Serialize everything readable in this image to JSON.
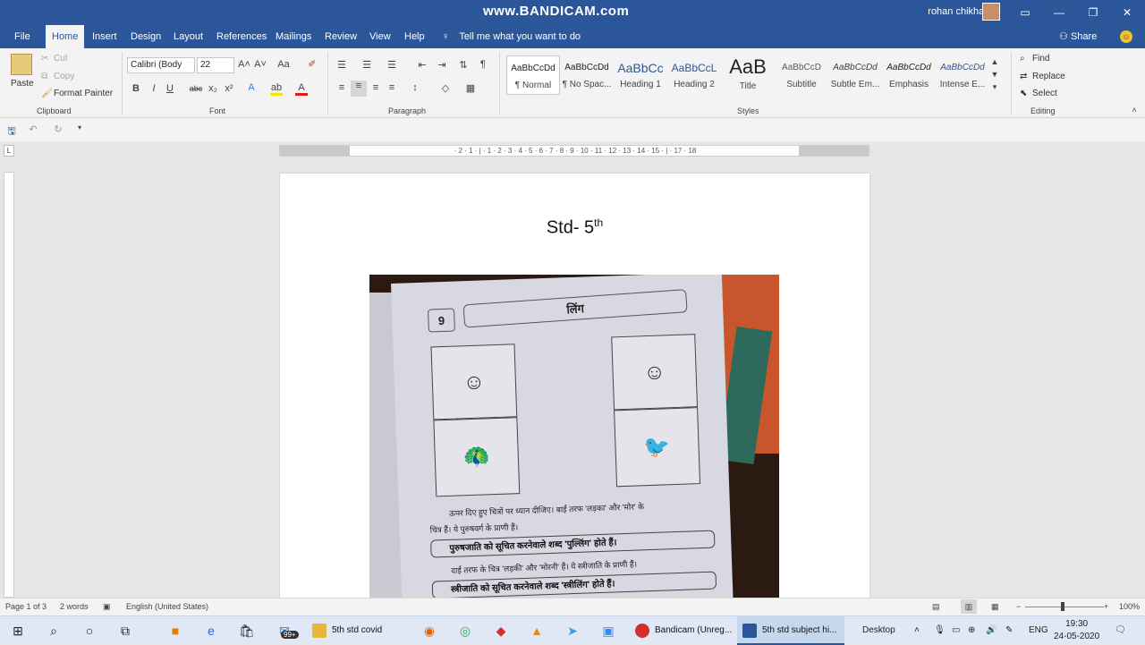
{
  "titlebar": {
    "watermark": "www.BANDICAM.com",
    "user_name": "rohan chikhalkar",
    "minimize": "—",
    "restore": "❐",
    "close": "✕",
    "ribbon_display": "▭"
  },
  "menu": {
    "items": [
      "File",
      "Home",
      "Insert",
      "Design",
      "Layout",
      "References",
      "Mailings",
      "Review",
      "View",
      "Help"
    ],
    "tell_me": "Tell me what you want to do",
    "share": "Share"
  },
  "ribbon": {
    "clipboard": {
      "paste": "Paste",
      "cut": "Cut",
      "copy": "Copy",
      "format_painter": "Format Painter",
      "label": "Clipboard"
    },
    "font": {
      "font_name": "Calibri (Body",
      "font_size": "22",
      "label": "Font",
      "change_case": "Aa",
      "bold": "B",
      "italic": "I",
      "underline": "U",
      "strike": "abc",
      "subscript": "x₂",
      "superscript": "x²"
    },
    "paragraph": {
      "label": "Paragraph",
      "pilcrow": "¶"
    },
    "styles": {
      "label": "Styles",
      "items": [
        {
          "sample": "AaBbCcDd",
          "name": "¶ Normal"
        },
        {
          "sample": "AaBbCcDd",
          "name": "¶ No Spac..."
        },
        {
          "sample": "AaBbCc",
          "name": "Heading 1"
        },
        {
          "sample": "AaBbCcL",
          "name": "Heading 2"
        },
        {
          "sample": "AaB",
          "name": "Title"
        },
        {
          "sample": "AaBbCcD",
          "name": "Subtitle"
        },
        {
          "sample": "AaBbCcDd",
          "name": "Subtle Em..."
        },
        {
          "sample": "AaBbCcDd",
          "name": "Emphasis"
        },
        {
          "sample": "AaBbCcDd",
          "name": "Intense E..."
        }
      ]
    },
    "editing": {
      "label": "Editing",
      "find": "Find",
      "replace": "Replace",
      "select": "Select"
    }
  },
  "ruler_numbers": "· 2 · 1 · | · 1 · 2 · 3 · 4 · 5 · 6 · 7 · 8 · 9 · 10 · 11 · 12 · 13 · 14 · 15 · | · 17 · 18",
  "document": {
    "heading": "Std- 5",
    "heading_sup": "th",
    "photo": {
      "lesson_number": "9",
      "lesson_title": "लिंग",
      "line1": "ऊपर दिए हुए चित्रों पर ध्यान दीजिए। बाईं तरफ 'लड़का' और 'मोर' के",
      "line2": "चित्र हैं। ये पुरुषवर्ग के प्राणी हैं।",
      "box1": "पुरुषजाति को सूचित करनेवाले शब्द 'पुल्लिंग' होते हैं।",
      "line3": "दाईं तरफ के चित्र 'लड़की' और 'मोरनी' हैं। ये स्त्रीजाति के प्राणी हैं।",
      "box2": "स्त्रीजाति को सूचित करनेवाले शब्द 'स्त्रीलिंग' होते हैं।"
    }
  },
  "status": {
    "page": "Page 1 of 3",
    "words": "2 words",
    "language": "English (United States)",
    "zoom": "100%"
  },
  "taskbar": {
    "badge": "99+",
    "apps": [
      {
        "label": "5th std covid",
        "color": "#e8b63a"
      },
      {
        "label": "Bandicam (Unreg...",
        "color": "#d32f2f"
      },
      {
        "label": "5th std subject hi...",
        "color": "#2b579a"
      }
    ],
    "desktop": "Desktop",
    "lang": "ENG",
    "time": "19:30",
    "date": "24-05-2020"
  }
}
